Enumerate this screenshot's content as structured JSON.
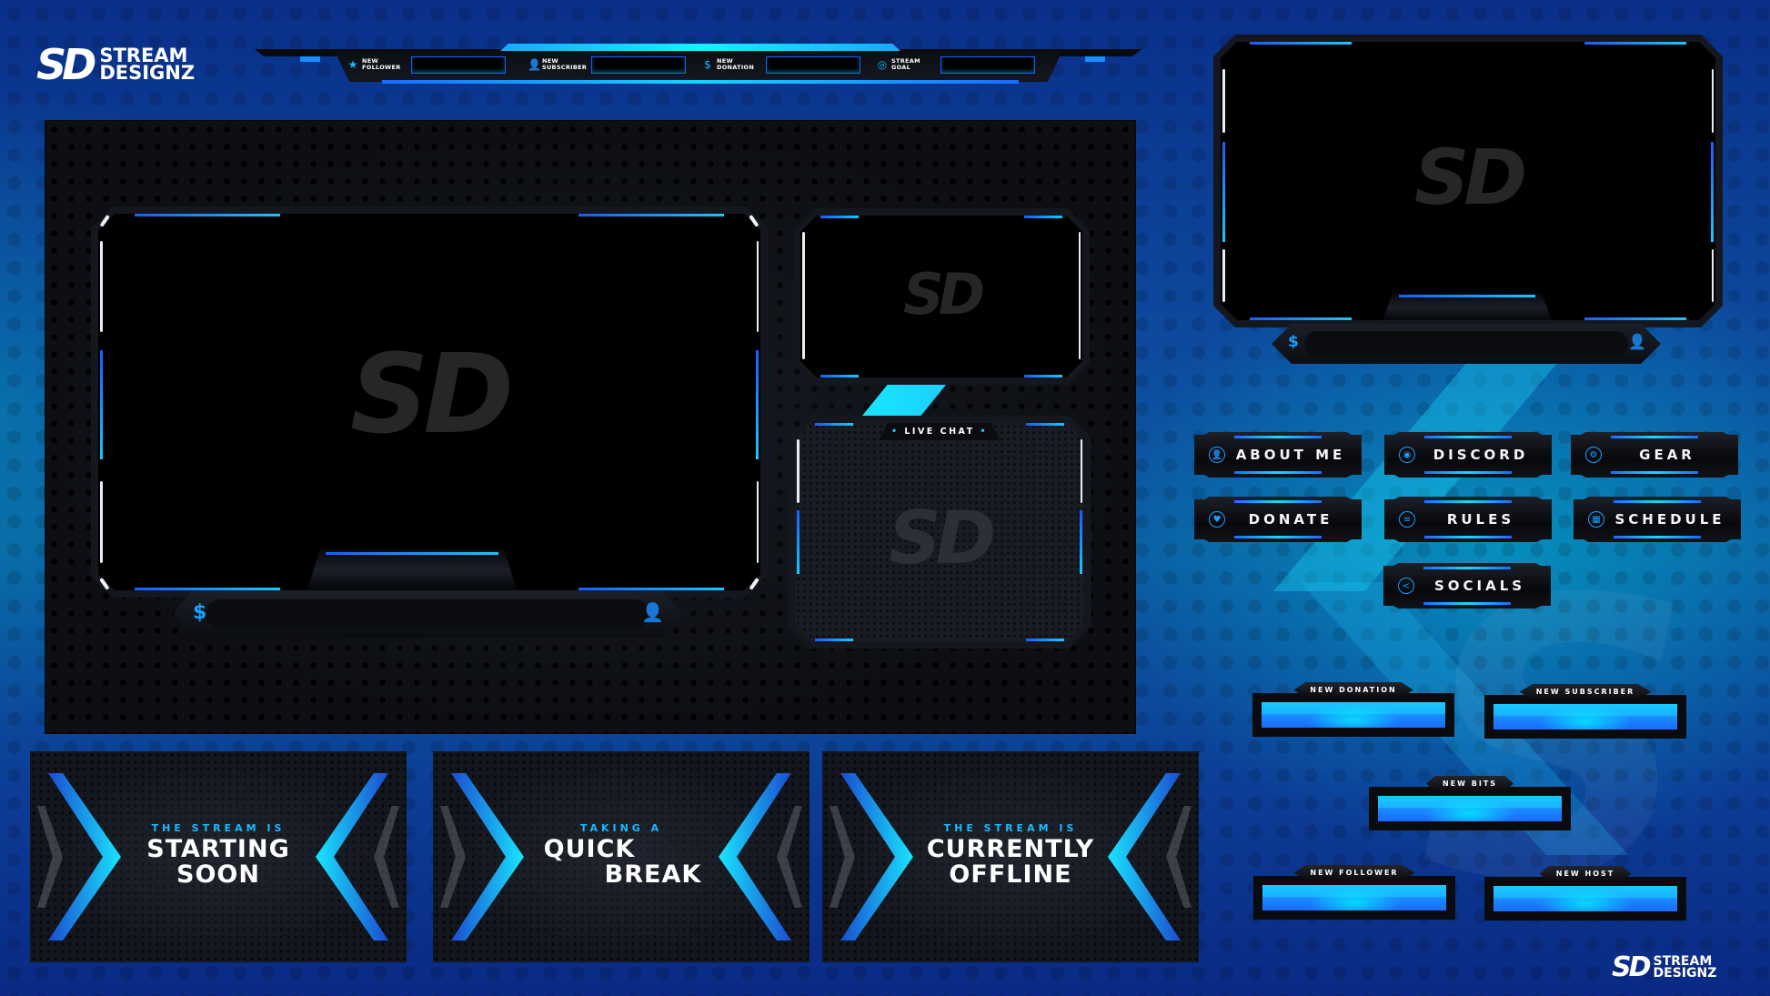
{
  "brand": {
    "mark": "SD",
    "name_line1": "STREAM",
    "name_line2": "DESIGNZ"
  },
  "top_bar": {
    "goals": [
      {
        "icon": "star-icon",
        "glyph": "★",
        "line1": "NEW",
        "line2": "FOLLOWER"
      },
      {
        "icon": "user-icon",
        "glyph": "👤",
        "line1": "NEW",
        "line2": "SUBSCRIBER"
      },
      {
        "icon": "dollar-icon",
        "glyph": "$",
        "line1": "NEW",
        "line2": "DONATION"
      },
      {
        "icon": "target-icon",
        "glyph": "◎",
        "line1": "STREAM",
        "line2": "GOAL"
      }
    ]
  },
  "main_cam": {
    "watermark": "SD",
    "left_icon": "$",
    "right_icon": "👤"
  },
  "side_cam": {
    "watermark": "SD"
  },
  "live_chat": {
    "title": "LIVE CHAT",
    "watermark": "SD",
    "bullet": "•"
  },
  "big_cam": {
    "watermark": "SD",
    "left_icon": "$",
    "right_icon": "👤"
  },
  "panels": [
    {
      "label": "ABOUT ME",
      "icon": "user-icon",
      "glyph": "👤"
    },
    {
      "label": "DISCORD",
      "icon": "discord-icon",
      "glyph": "◉"
    },
    {
      "label": "GEAR",
      "icon": "gear-icon",
      "glyph": "⚙"
    },
    {
      "label": "DONATE",
      "icon": "donate-heart-icon",
      "glyph": "♥"
    },
    {
      "label": "RULES",
      "icon": "rules-document-icon",
      "glyph": "≡"
    },
    {
      "label": "SCHEDULE",
      "icon": "calendar-icon",
      "glyph": "▦"
    },
    {
      "label": "SOCIALS",
      "icon": "share-icon",
      "glyph": "<"
    }
  ],
  "alerts": [
    {
      "label": "NEW DONATION"
    },
    {
      "label": "NEW SUBSCRIBER"
    },
    {
      "label": "NEW BITS"
    },
    {
      "label": "NEW FOLLOWER"
    },
    {
      "label": "NEW HOST"
    }
  ],
  "scenes": [
    {
      "subtitle": "THE STREAM IS",
      "line1": "STARTING",
      "line2": "SOON"
    },
    {
      "subtitle": "TAKING A",
      "line1": "QUICK",
      "line2": "BREAK"
    },
    {
      "subtitle": "THE STREAM IS",
      "line1": "CURRENTLY",
      "line2": "OFFLINE"
    }
  ],
  "colors": {
    "accent_blue": "#1a6bff",
    "accent_cyan": "#19e6ff",
    "frame_black": "#000000",
    "background_navy": "#0a2f8a"
  }
}
